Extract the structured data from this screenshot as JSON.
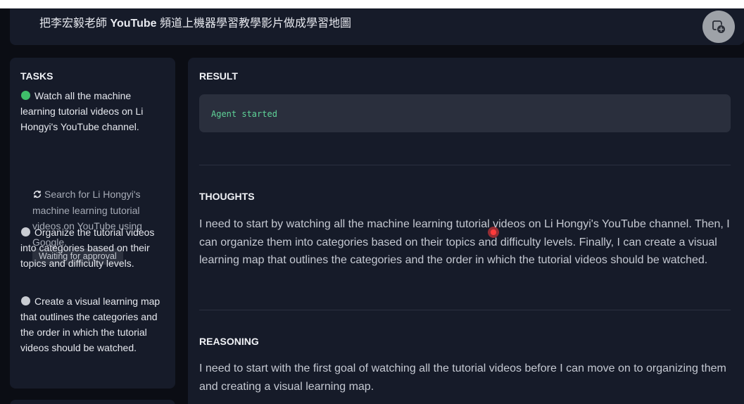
{
  "header": {
    "title_prefix": "把李宏毅老師",
    "title_bold": "YouTube",
    "title_suffix": "頻道上機器學習教學影片做成學習地圖",
    "action_icon": "chat-add-icon"
  },
  "tasks": {
    "title": "TASKS",
    "items": [
      {
        "status": "active",
        "status_color": "#3fbf6a",
        "text": "Watch all the machine learning tutorial videos on Li Hongyi's YouTube channel."
      },
      {
        "status": "pending",
        "status_color": "#c9ccd2",
        "text": "Organize the tutorial videos into categories based on their topics and difficulty levels."
      },
      {
        "status": "pending",
        "status_color": "#c9ccd2",
        "text": "Create a visual learning map that outlines the categories and the order in which the tutorial videos should be watched."
      }
    ],
    "subtask": {
      "icon": "refresh-icon",
      "text": "Search for Li Hongyi's machine learning tutorial videos on YouTube using Google.",
      "badge": "Waiting for approval"
    }
  },
  "result": {
    "title": "RESULT",
    "code": "Agent started"
  },
  "thoughts": {
    "title": "THOUGHTS",
    "text": "I need to start by watching all the machine learning tutorial videos on Li Hongyi's YouTube channel. Then, I can organize them into categories based on their topics and difficulty levels. Finally, I can create a visual learning map that outlines the categories and the order in which the tutorial videos should be watched."
  },
  "reasoning": {
    "title": "REASONING",
    "text": "I need to start with the first goal of watching all the tutorial videos before I can move on to organizing them and creating a visual learning map."
  },
  "colors": {
    "background": "#0b0d14",
    "panel": "#161b29",
    "code_green": "#5fd398",
    "active_dot": "#3fbf6a"
  }
}
